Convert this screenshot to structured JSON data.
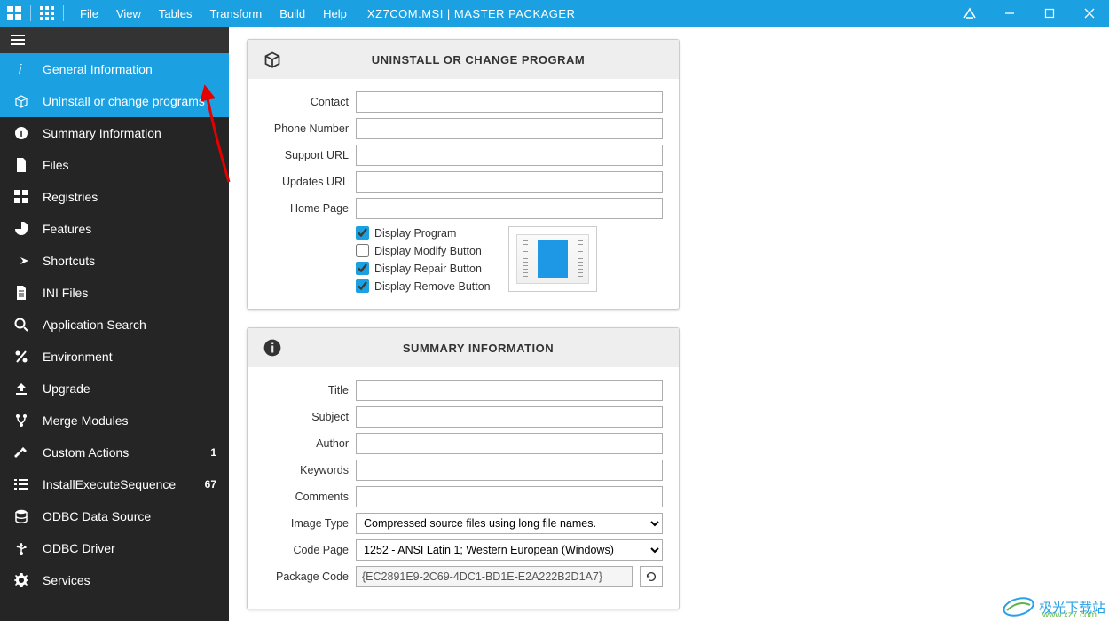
{
  "titlebar": {
    "menus": [
      "File",
      "View",
      "Tables",
      "Transform",
      "Build",
      "Help"
    ],
    "title": "XZ7COM.MSI | MASTER PACKAGER"
  },
  "sidebar": {
    "items": [
      {
        "label": "General Information",
        "icon": "info-italic"
      },
      {
        "label": "Uninstall or change programs",
        "icon": "package"
      },
      {
        "label": "Summary Information",
        "icon": "info-circle"
      },
      {
        "label": "Files",
        "icon": "file"
      },
      {
        "label": "Registries",
        "icon": "grid"
      },
      {
        "label": "Features",
        "icon": "pie"
      },
      {
        "label": "Shortcuts",
        "icon": "share"
      },
      {
        "label": "INI Files",
        "icon": "doc"
      },
      {
        "label": "Application Search",
        "icon": "search"
      },
      {
        "label": "Environment",
        "icon": "percent"
      },
      {
        "label": "Upgrade",
        "icon": "upload"
      },
      {
        "label": "Merge Modules",
        "icon": "merge"
      },
      {
        "label": "Custom Actions",
        "icon": "tools",
        "badge": "1"
      },
      {
        "label": "InstallExecuteSequence",
        "icon": "list",
        "badge": "67"
      },
      {
        "label": "ODBC Data Source",
        "icon": "database"
      },
      {
        "label": "ODBC Driver",
        "icon": "usb"
      },
      {
        "label": "Services",
        "icon": "gear"
      }
    ]
  },
  "panel1": {
    "title": "UNINSTALL OR CHANGE PROGRAM",
    "fields": {
      "contact": {
        "label": "Contact",
        "value": ""
      },
      "phone": {
        "label": "Phone Number",
        "value": ""
      },
      "support": {
        "label": "Support URL",
        "value": ""
      },
      "updates": {
        "label": "Updates URL",
        "value": ""
      },
      "home": {
        "label": "Home Page",
        "value": ""
      }
    },
    "checks": {
      "display_program": {
        "label": "Display Program",
        "checked": true
      },
      "display_modify": {
        "label": "Display Modify Button",
        "checked": false
      },
      "display_repair": {
        "label": "Display Repair Button",
        "checked": true
      },
      "display_remove": {
        "label": "Display Remove Button",
        "checked": true
      }
    }
  },
  "panel2": {
    "title": "SUMMARY INFORMATION",
    "fields": {
      "title": {
        "label": "Title",
        "value": ""
      },
      "subject": {
        "label": "Subject",
        "value": ""
      },
      "author": {
        "label": "Author",
        "value": ""
      },
      "keywords": {
        "label": "Keywords",
        "value": ""
      },
      "comments": {
        "label": "Comments",
        "value": ""
      },
      "image_type": {
        "label": "Image Type",
        "value": "Compressed source files using long file names."
      },
      "code_page": {
        "label": "Code Page",
        "value": "1252 - ANSI Latin 1; Western European (Windows)"
      },
      "package_code": {
        "label": "Package Code",
        "value": "{EC2891E9-2C69-4DC1-BD1E-E2A222B2D1A7}"
      }
    }
  },
  "watermark": {
    "text": "极光下载站",
    "url": "www.xz7.com"
  }
}
